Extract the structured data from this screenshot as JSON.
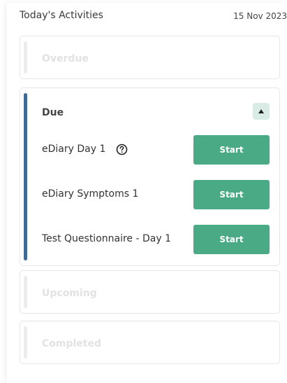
{
  "header": {
    "title": "Today's Activities",
    "date": "15 Nov 2023"
  },
  "sections": {
    "overdue": {
      "label": "Overdue"
    },
    "due": {
      "label": "Due",
      "items": [
        {
          "label": "eDiary Day 1",
          "action": "Start"
        },
        {
          "label": "eDiary Symptoms 1",
          "action": "Start"
        },
        {
          "label": "Test Questionnaire - Day 1",
          "action": "Start"
        }
      ]
    },
    "upcoming": {
      "label": "Upcoming"
    },
    "completed": {
      "label": "Completed"
    }
  },
  "colors": {
    "accent": "#4aaa85",
    "due_bar": "#3f6a94",
    "toggle_bg": "#d9ebe5"
  },
  "icons": {
    "toggle": "caret-up-icon",
    "help": "question-circle-icon"
  }
}
